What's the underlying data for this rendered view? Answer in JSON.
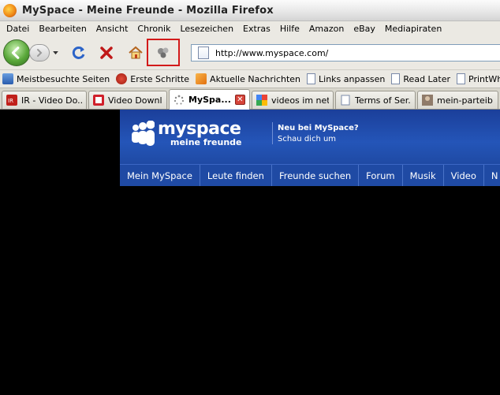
{
  "window": {
    "title": "MySpace - Meine Freunde - Mozilla Firefox"
  },
  "menu": [
    {
      "label": "Datei"
    },
    {
      "label": "Bearbeiten"
    },
    {
      "label": "Ansicht"
    },
    {
      "label": "Chronik"
    },
    {
      "label": "Lesezeichen"
    },
    {
      "label": "Extras"
    },
    {
      "label": "Hilfe"
    },
    {
      "label": "Amazon"
    },
    {
      "label": "eBay"
    },
    {
      "label": "Mediapiraten"
    }
  ],
  "navbar": {
    "url": "http://www.myspace.com/",
    "icons": [
      "back-arrow-icon",
      "forward-arrow-icon",
      "dropdown-arrow-icon",
      "reload-icon",
      "stop-icon",
      "home-icon",
      "extension-icon"
    ]
  },
  "bookmarks": [
    {
      "label": "Meistbesuchte Seiten",
      "icon": "bookmark-folder-icon"
    },
    {
      "label": "Erste Schritte",
      "icon": "firefox-icon"
    },
    {
      "label": "Aktuelle Nachrichten",
      "icon": "rss-icon"
    },
    {
      "label": "Links anpassen",
      "icon": "page-icon"
    },
    {
      "label": "Read Later",
      "icon": "page-icon"
    },
    {
      "label": "PrintWhatYouLike",
      "icon": "page-icon"
    }
  ],
  "tabs": [
    {
      "label": "IR - Video Do..."
    },
    {
      "label": "Video Downl..."
    },
    {
      "label": "MySpa...",
      "active": true
    },
    {
      "label": "videos im net..."
    },
    {
      "label": "Terms of Ser..."
    },
    {
      "label": "mein-parteib..."
    }
  ],
  "myspace": {
    "logo_big": "myspace",
    "logo_small": "meine freunde",
    "promo_title": "Neu bei MySpace?",
    "promo_link": "Schau dich um",
    "nav": [
      "Mein MySpace",
      "Leute finden",
      "Freunde suchen",
      "Forum",
      "Musik",
      "Video",
      "N"
    ]
  },
  "colors": {
    "highlight": "#d21a1a",
    "myspace_blue": "#1f4aa4"
  }
}
